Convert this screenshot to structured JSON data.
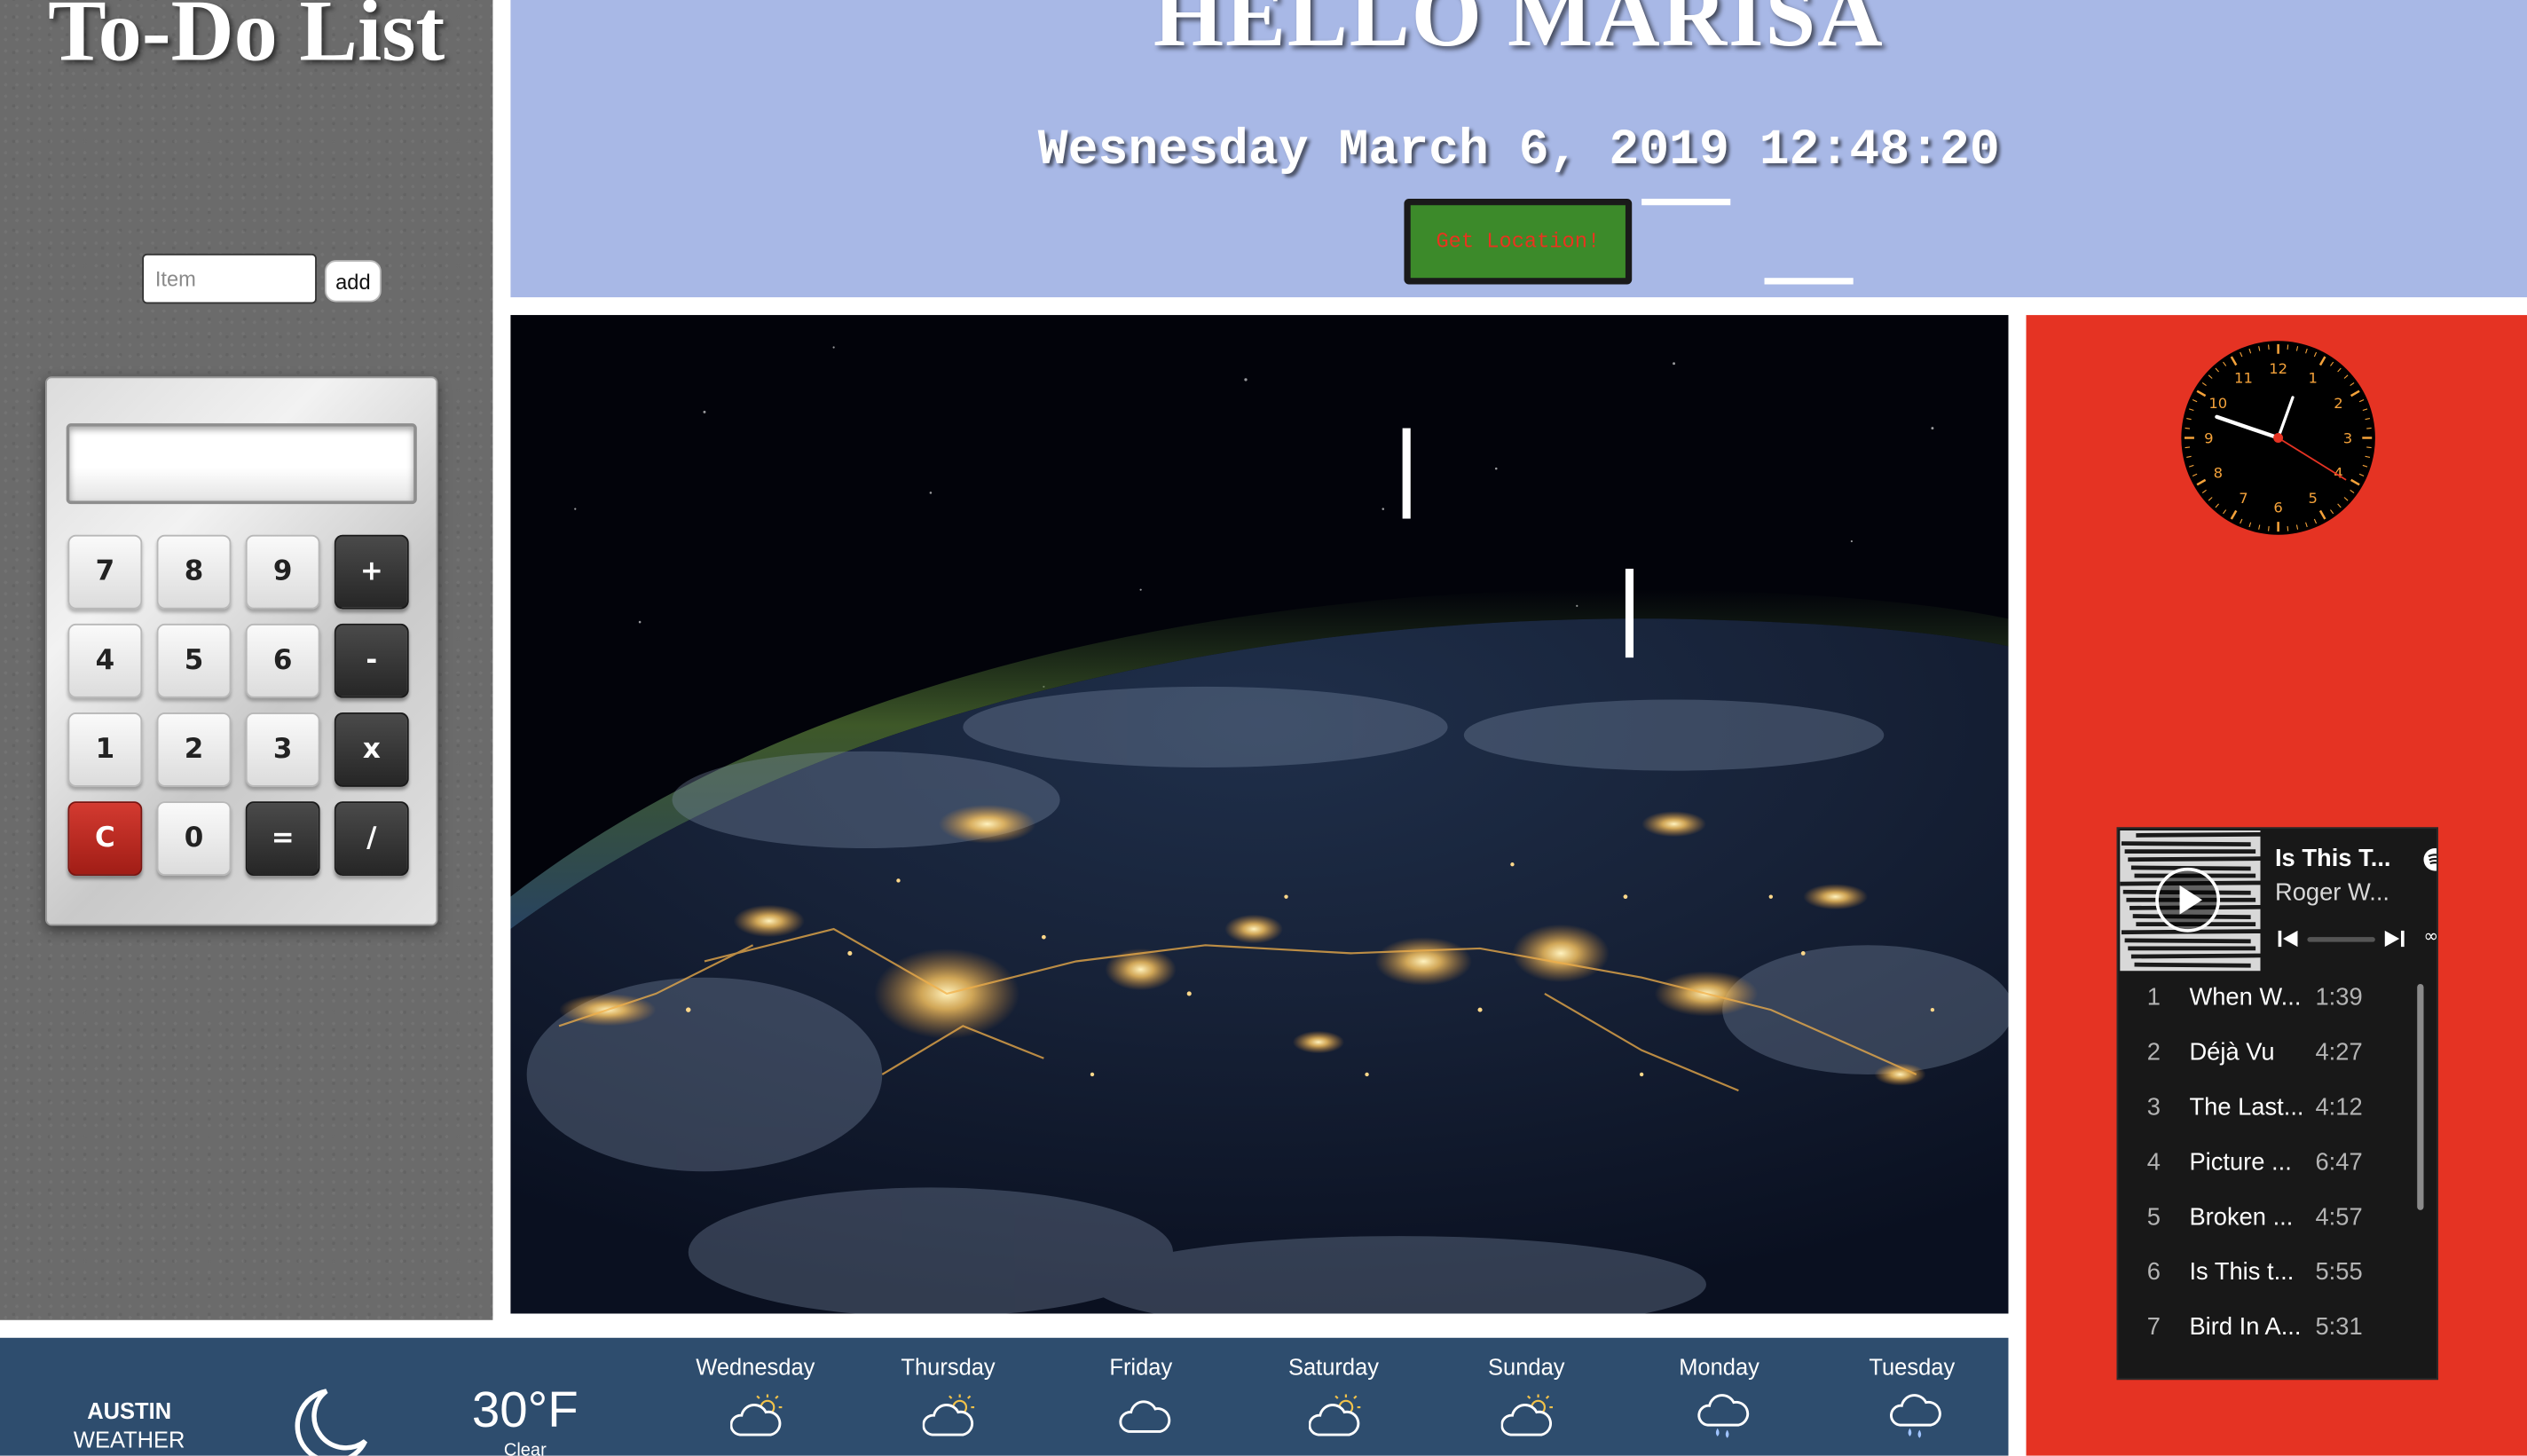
{
  "todo": {
    "title": "To-Do List",
    "input_placeholder": "Item",
    "add_label": "add"
  },
  "calculator": {
    "display": "",
    "keys": [
      "7",
      "8",
      "9",
      "+",
      "4",
      "5",
      "6",
      "-",
      "1",
      "2",
      "3",
      "x",
      "C",
      "0",
      "=",
      "/"
    ]
  },
  "header": {
    "greeting": "HELLO MARISA",
    "datetime": "Wesnesday March 6, 2019 12:48:20",
    "location_button": "Get Location!"
  },
  "clock": {
    "numerals": [
      "12",
      "1",
      "2",
      "3",
      "4",
      "5",
      "6",
      "7",
      "8",
      "9",
      "10",
      "11"
    ],
    "time": "12:48:20"
  },
  "player": {
    "now_playing_title": "Is This T...",
    "now_playing_artist": "Roger W...",
    "tracks": [
      {
        "num": "1",
        "title": "When W...",
        "duration": "1:39"
      },
      {
        "num": "2",
        "title": "Déjà Vu",
        "duration": "4:27"
      },
      {
        "num": "3",
        "title": "The Last...",
        "duration": "4:12"
      },
      {
        "num": "4",
        "title": "Picture ...",
        "duration": "6:47"
      },
      {
        "num": "5",
        "title": "Broken ...",
        "duration": "4:57"
      },
      {
        "num": "6",
        "title": "Is This t...",
        "duration": "5:55"
      },
      {
        "num": "7",
        "title": "Bird In A...",
        "duration": "5:31"
      }
    ]
  },
  "weather": {
    "city": "AUSTIN",
    "label": "WEATHER",
    "current_icon": "moon-icon",
    "temperature": "30°F",
    "condition": "Clear",
    "forecast": [
      {
        "day": "Wednesday",
        "icon": "partly-cloudy-icon"
      },
      {
        "day": "Thursday",
        "icon": "partly-cloudy-icon"
      },
      {
        "day": "Friday",
        "icon": "cloud-icon"
      },
      {
        "day": "Saturday",
        "icon": "partly-cloudy-icon"
      },
      {
        "day": "Sunday",
        "icon": "partly-cloudy-icon"
      },
      {
        "day": "Monday",
        "icon": "rain-cloud-icon"
      },
      {
        "day": "Tuesday",
        "icon": "rain-cloud-icon"
      }
    ]
  },
  "colors": {
    "header_bg": "#a8b8e6",
    "right_panel_bg": "#e53323",
    "weather_bg": "#2e4d6e",
    "location_button_bg": "#3c8a2a",
    "location_button_text": "#e8341f"
  }
}
